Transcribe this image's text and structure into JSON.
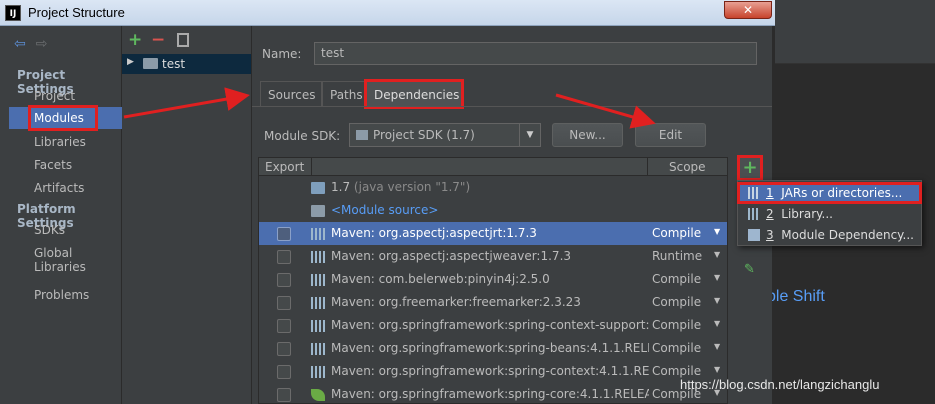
{
  "window": {
    "title": "Project Structure",
    "logo_text": "IJ",
    "close_label": "✕"
  },
  "nav": {
    "back_glyph": "⇦",
    "forward_glyph": "⇨",
    "project_settings_header": "Project Settings",
    "project_settings": [
      "Project",
      "Modules",
      "Libraries",
      "Facets",
      "Artifacts"
    ],
    "platform_settings_header": "Platform Settings",
    "platform_settings": [
      "SDKs",
      "Global Libraries"
    ],
    "other": [
      "Problems"
    ],
    "selected": "Modules"
  },
  "tree": {
    "add_glyph": "+",
    "remove_glyph": "−",
    "module_name": "test"
  },
  "main": {
    "name_label": "Name:",
    "name_value": "test",
    "tabs": [
      "Sources",
      "Paths",
      "Dependencies"
    ],
    "active_tab": "Dependencies",
    "sdk_label": "Module SDK:",
    "sdk_value": "Project SDK (1.7)",
    "new_button": "New...",
    "edit_button": "Edit",
    "table": {
      "col_export": "Export",
      "col_scope": "Scope",
      "rows": [
        {
          "name": "1.7",
          "detail": "(java version \"1.7\")",
          "scope": "",
          "icon": "sdk-icon",
          "checkbox": false
        },
        {
          "name": "<Module source>",
          "detail": "",
          "scope": "",
          "icon": "folder-icon",
          "checkbox": false,
          "link": true
        },
        {
          "name": "Maven: org.aspectj:aspectjrt:1.7.3",
          "scope": "Compile",
          "icon": "library-icon",
          "checkbox": true,
          "selected": true
        },
        {
          "name": "Maven: org.aspectj:aspectjweaver:1.7.3",
          "scope": "Runtime",
          "icon": "library-icon",
          "checkbox": true
        },
        {
          "name": "Maven: com.belerweb:pinyin4j:2.5.0",
          "scope": "Compile",
          "icon": "library-icon",
          "checkbox": true
        },
        {
          "name": "Maven: org.freemarker:freemarker:2.3.23",
          "scope": "Compile",
          "icon": "library-icon",
          "checkbox": true
        },
        {
          "name": "Maven: org.springframework:spring-context-support:4",
          "scope": "Compile",
          "icon": "library-icon",
          "checkbox": true
        },
        {
          "name": "Maven: org.springframework:spring-beans:4.1.1.RELEA",
          "scope": "Compile",
          "icon": "library-icon",
          "checkbox": true
        },
        {
          "name": "Maven: org.springframework:spring-context:4.1.1.RELE",
          "scope": "Compile",
          "icon": "library-icon",
          "checkbox": true
        },
        {
          "name": "Maven: org.springframework:spring-core:4.1.1.RELEAS",
          "scope": "Compile",
          "icon": "spring-icon",
          "checkbox": true
        }
      ]
    }
  },
  "side_toolbar": {
    "add_glyph": "+",
    "edit_glyph": "✎"
  },
  "popup": {
    "items": [
      {
        "num": "1",
        "label": "JARs or directories...",
        "icon": "jar-icon"
      },
      {
        "num": "2",
        "label": "Library...",
        "icon": "library-icon"
      },
      {
        "num": "3",
        "label": "Module Dependency...",
        "icon": "module-icon"
      }
    ]
  },
  "background_hint": "ble Shift",
  "watermark": "https://blog.csdn.net/langzichanglu",
  "colors": {
    "selection": "#4b6eaf",
    "annotation_red": "#e02020",
    "panel": "#3c3f41"
  }
}
